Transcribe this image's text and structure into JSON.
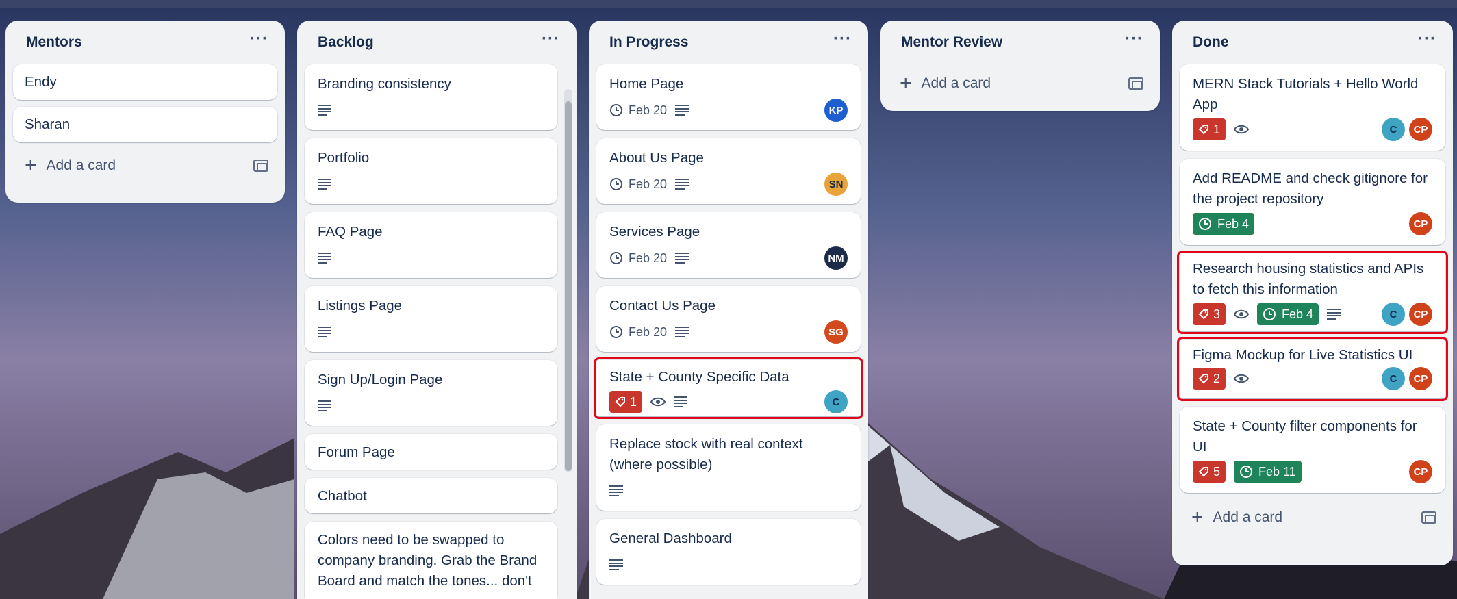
{
  "lists": {
    "mentors": {
      "title": "Mentors",
      "cards": [
        "Endy",
        "Sharan"
      ],
      "add_label": "Add a card"
    },
    "backlog": {
      "title": "Backlog",
      "cards": [
        "Branding consistency",
        "Portfolio",
        "FAQ Page",
        "Listings Page",
        "Sign Up/Login Page",
        "Forum Page",
        "Chatbot",
        "Colors need to be swapped to company branding. Grab the Brand Board and match the tones... don't"
      ]
    },
    "in_progress": {
      "title": "In Progress",
      "cards": [
        {
          "title": "Home Page",
          "date": "Feb 20",
          "avatar": "KP"
        },
        {
          "title": "About Us Page",
          "date": "Feb 20",
          "avatar": "SN"
        },
        {
          "title": "Services Page",
          "date": "Feb 20",
          "avatar": "NM"
        },
        {
          "title": "Contact Us Page",
          "date": "Feb 20",
          "avatar": "SG"
        },
        {
          "title": "State + County Specific Data",
          "label_count": "1",
          "avatar": "C"
        },
        {
          "title": "Replace stock with real context (where possible)"
        },
        {
          "title": "General Dashboard"
        }
      ]
    },
    "mentor_review": {
      "title": "Mentor Review",
      "add_label": "Add a card"
    },
    "done": {
      "title": "Done",
      "cards": [
        {
          "title": "MERN Stack Tutorials + Hello World App",
          "label_count": "1",
          "avatars": [
            "C",
            "CP"
          ]
        },
        {
          "title": "Add README and check gitignore for the project repository",
          "date": "Feb 4",
          "avatars": [
            "CP"
          ]
        },
        {
          "title": "Research housing statistics and APIs to fetch this information",
          "label_count": "3",
          "date": "Feb 4",
          "avatars": [
            "C",
            "CP"
          ]
        },
        {
          "title": "Figma Mockup for Live Statistics UI",
          "label_count": "2",
          "avatars": [
            "C",
            "CP"
          ]
        },
        {
          "title": "State + County filter components for UI",
          "label_count": "5",
          "date": "Feb 11",
          "avatars": [
            "CP"
          ]
        }
      ],
      "add_label": "Add a card"
    }
  },
  "menu_icon": "more-horizontal-icon",
  "colors": {
    "list_bg": "#f1f2f4",
    "label_red": "#c9372c",
    "date_green": "#1f845a",
    "highlight": "#e0071b",
    "avatar_kp": "#1d5fd1",
    "avatar_sn": "#e8a33a",
    "avatar_nm": "#1c2b4a",
    "avatar_sg": "#d34a1f",
    "avatar_c": "#3fa3c4",
    "avatar_cp": "#d0421a"
  }
}
